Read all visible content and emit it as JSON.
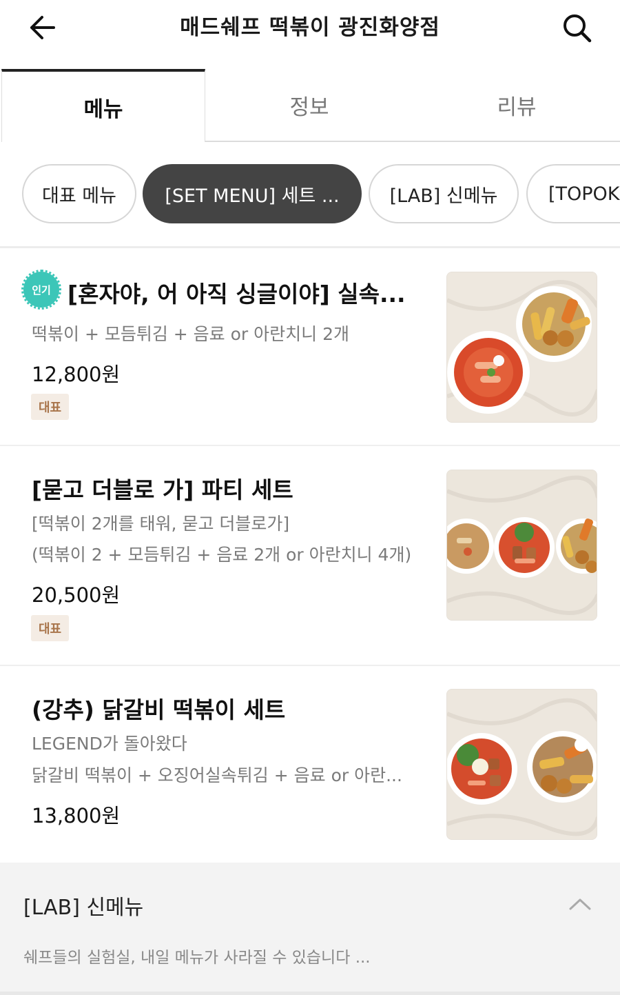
{
  "header": {
    "title": "매드쉐프 떡볶이 광진화양점",
    "back_icon": "arrow-left-icon",
    "search_icon": "search-icon"
  },
  "tabs": [
    {
      "label": "메뉴",
      "active": true
    },
    {
      "label": "정보",
      "active": false
    },
    {
      "label": "리뷰",
      "active": false
    }
  ],
  "categories": [
    {
      "label": "대표 메뉴",
      "active": false
    },
    {
      "label": "[SET MENU] 세트 ...",
      "active": true
    },
    {
      "label": "[LAB] 신메뉴",
      "active": false
    },
    {
      "label": "[TOPOKKI",
      "active": false
    }
  ],
  "menu_items": [
    {
      "badge": "인기",
      "name": "[혼자야, 어 아직 싱글이야] 실속...",
      "desc_lines": [
        "떡볶이 + 모듬튀김 + 음료 or 아란치니 2개"
      ],
      "price": "12,800원",
      "tag": "대표"
    },
    {
      "name": "[묻고 더블로 가] 파티 세트",
      "desc_lines": [
        "[떡볶이 2개를 태워, 묻고 더블로가]",
        "(떡볶이 2 + 모듬튀김 + 음료 2개 or 아란치니 4개)"
      ],
      "price": "20,500원",
      "tag": "대표"
    },
    {
      "name": "(강추) 닭갈비 떡볶이 세트",
      "desc_lines": [
        "LEGEND가 돌아왔다",
        "닭갈비 떡볶이 + 오징어실속튀김 + 음료 or 아란..."
      ],
      "price": "13,800원"
    }
  ],
  "section": {
    "title": "[LAB] 신메뉴",
    "description": "쉐프들의 실험실, 내일 메뉴가 사라질 수 있습니다 ...",
    "collapse_icon": "chevron-up-icon"
  },
  "colors": {
    "active_chip": "#444444",
    "popular_badge": "#3cc6b8",
    "tag_bg": "#f4ece4",
    "tag_text": "#a8744a"
  }
}
